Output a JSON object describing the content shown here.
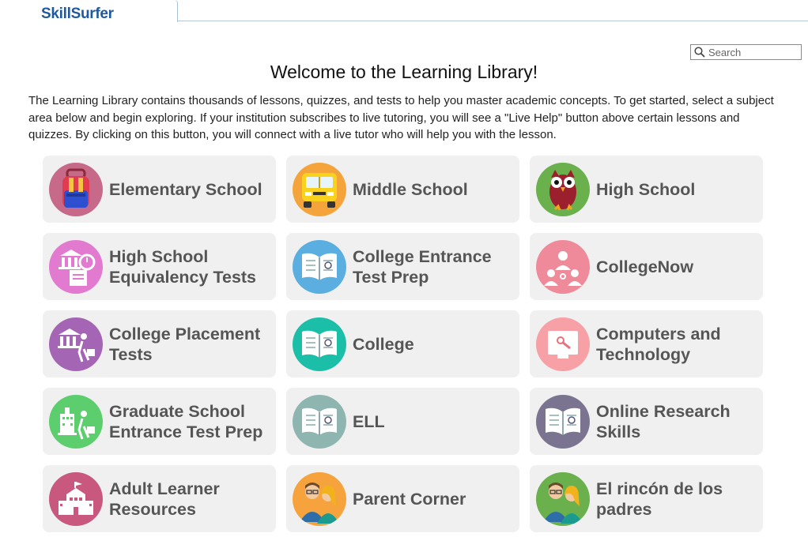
{
  "header": {
    "brand": "SkillSurfer"
  },
  "search": {
    "placeholder": "Search"
  },
  "page": {
    "title": "Welcome to the Learning Library!",
    "intro": "The Learning Library contains thousands of lessons, quizzes, and tests to help you master academic concepts. To get started, select a subject area below and begin exploring. If your institution subscribes to live tutoring, you will see a \"Live Help\" button above certain lessons and quizzes. By clicking on this button, you will connect with a live tutor who will help you with the lesson."
  },
  "subjects": [
    {
      "label": "Elementary School",
      "icon": "backpack-icon",
      "color": "#c76a8a"
    },
    {
      "label": "Middle School",
      "icon": "school-bus-icon",
      "color": "#f5a43c"
    },
    {
      "label": "High School",
      "icon": "owl-icon",
      "color": "#6ab04c"
    },
    {
      "label": "High School Equivalency Tests",
      "icon": "test-stopwatch-icon",
      "color": "#e27ad0"
    },
    {
      "label": "College Entrance Test Prep",
      "icon": "open-book-icon",
      "color": "#5aaee0"
    },
    {
      "label": "CollegeNow",
      "icon": "people-network-icon",
      "color": "#ee8a99"
    },
    {
      "label": "College Placement Tests",
      "icon": "student-building-icon",
      "color": "#a466b4"
    },
    {
      "label": "College",
      "icon": "open-book-icon",
      "color": "#1bbfa8"
    },
    {
      "label": "Computers and Technology",
      "icon": "computer-screen-icon",
      "color": "#f7a0a6"
    },
    {
      "label": "Graduate School Entrance Test Prep",
      "icon": "graduate-building-icon",
      "color": "#5cce6e"
    },
    {
      "label": "ELL",
      "icon": "open-book-icon",
      "color": "#8fb5b1"
    },
    {
      "label": "Online Research Skills",
      "icon": "open-book-icon",
      "color": "#7a7490"
    },
    {
      "label": "Adult Learner Resources",
      "icon": "city-hall-icon",
      "color": "#c8587e"
    },
    {
      "label": "Parent Corner",
      "icon": "parents-icon",
      "color": "#f6a33e"
    },
    {
      "label": "El rincón de los padres",
      "icon": "parents-icon",
      "color": "#6ab04c"
    }
  ]
}
